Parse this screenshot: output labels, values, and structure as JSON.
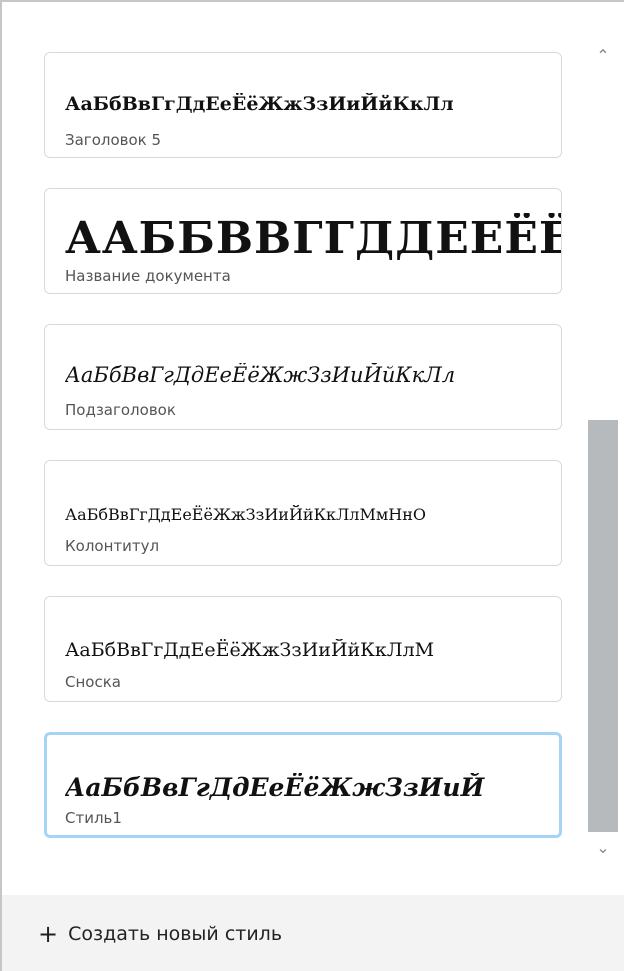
{
  "styles": [
    {
      "sample": "АаБбВвГгДдЕеЁёЖжЗзИиЙйКкЛл",
      "name": "Заголовок 5"
    },
    {
      "sample": "ААББВВГГДДЕЕЁЁ",
      "name": "Название документа"
    },
    {
      "sample": "АаБбВвГгДдЕеЁёЖжЗзИиЙйКкЛл",
      "name": "Подзаголовок"
    },
    {
      "sample": "АаБбВвГгДдЕеЁёЖжЗзИиЙйКкЛлМмНнО",
      "name": "Колонтитул"
    },
    {
      "sample": "АаБбВвГгДдЕеЁёЖжЗзИиЙйКкЛлМ",
      "name": "Сноска"
    },
    {
      "sample": "АаБбВвГгДдЕеЁёЖжЗзИиЙ",
      "name": "Стиль1",
      "selected": true
    }
  ],
  "scrollbar": {
    "up_icon": "chevron-up-icon",
    "down_icon": "chevron-down-icon",
    "up_glyph": "⌃",
    "down_glyph": "⌄"
  },
  "footer": {
    "plus_glyph": "+",
    "new_style_label": "Создать новый стиль"
  },
  "colors": {
    "selected_border": "#a6d4f5",
    "card_border": "#d9d9d9",
    "footer_bg": "#f3f3f3",
    "scroll_thumb": "#b7babd"
  }
}
